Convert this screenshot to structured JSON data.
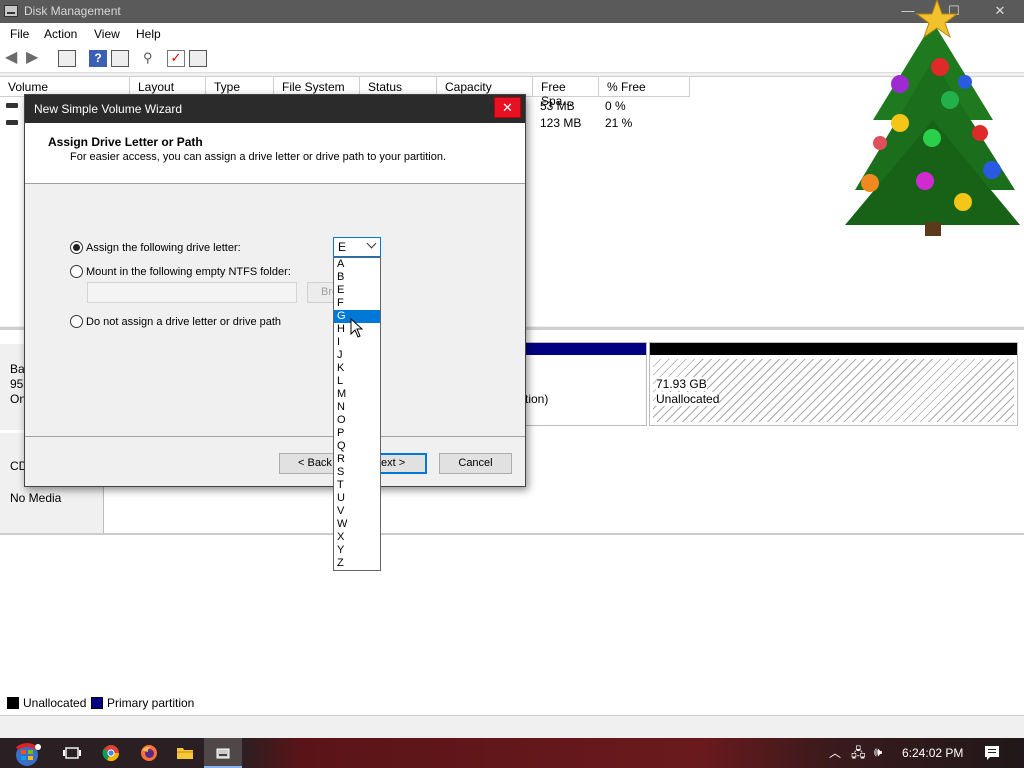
{
  "window": {
    "title": "Disk Management",
    "minimize": "—",
    "maximize": "☐",
    "close": "✕"
  },
  "menu": [
    "File",
    "Action",
    "View",
    "Help"
  ],
  "volume_list": {
    "columns": [
      "Volume",
      "Layout",
      "Type",
      "File System",
      "Status",
      "Capacity",
      "Free Spa...",
      "% Free"
    ],
    "rows": [
      {
        "free_space": "53 MB",
        "percent_free": "0 %"
      },
      {
        "free_space": "123 MB",
        "percent_free": "21 %"
      }
    ]
  },
  "disks": [
    {
      "label_lines": [
        "Ba",
        "95",
        "On"
      ],
      "partition_tail": "tion)",
      "unallocated_size": "71.93 GB",
      "unallocated_label": "Unallocated"
    },
    {
      "label": "CD",
      "media": "No Media"
    }
  ],
  "legend": [
    {
      "label": "Unallocated",
      "color": "#000000"
    },
    {
      "label": "Primary partition",
      "color": "#000080"
    }
  ],
  "wizard": {
    "title": "New Simple Volume Wizard",
    "heading": "Assign Drive Letter or Path",
    "subheading": "For easier access, you can assign a drive letter or drive path to your partition.",
    "options": [
      {
        "label": "Assign the following drive letter:",
        "selected": true
      },
      {
        "label": "Mount in the following empty NTFS folder:",
        "selected": false
      },
      {
        "label": "Do not assign a drive letter or drive path",
        "selected": false
      }
    ],
    "browse_label": "Bro",
    "back_label": "< Back",
    "next_label": "ext >",
    "cancel_label": "Cancel",
    "drive_letter": "E",
    "dropdown_options": [
      "A",
      "B",
      "E",
      "F",
      "G",
      "H",
      "I",
      "J",
      "K",
      "L",
      "M",
      "N",
      "O",
      "P",
      "Q",
      "R",
      "S",
      "T",
      "U",
      "V",
      "W",
      "X",
      "Y",
      "Z"
    ],
    "highlighted_option": "G"
  },
  "taskbar": {
    "time": "6:24:02 PM"
  },
  "colors": {
    "accent": "#0078d7",
    "primary_partition": "#000080",
    "close_red": "#e81123"
  }
}
